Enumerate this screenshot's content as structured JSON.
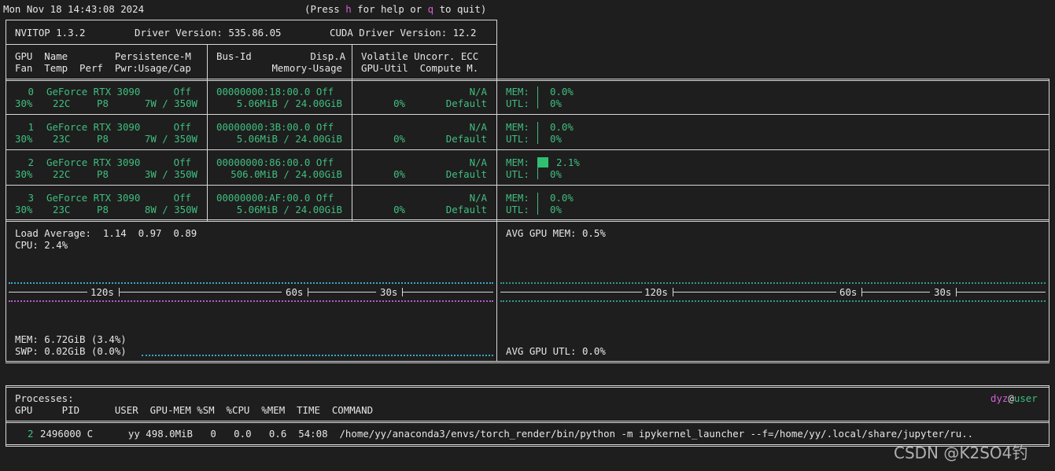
{
  "header": {
    "datetime": "Mon Nov 18 14:43:08 2024",
    "help_prefix": "(Press ",
    "help_key": "h",
    "help_mid": " for help or ",
    "quit_key": "q",
    "help_suffix": " to quit)"
  },
  "info": {
    "version": "NVITOP 1.3.2",
    "driver": "Driver Version: 535.86.05",
    "cuda": "CUDA Driver Version: 12.2"
  },
  "columns": {
    "c1_l1": "GPU  Name        Persistence-M",
    "c1_l2": "Fan  Temp  Perf  Pwr:Usage/Cap",
    "c2_l1": "Bus-Id          Disp.A",
    "c2_l2": "Memory-Usage",
    "c3_l1": "Volatile Uncorr. ECC",
    "c3_l2": "GPU-Util  Compute M."
  },
  "gpus": [
    {
      "id": "0",
      "name": "GeForce RTX 3090",
      "persist": "Off",
      "fan": "30%",
      "temp": "22C",
      "perf": "P8",
      "pwr": "7W / 350W",
      "bus": "00000000:18:00.0 Off",
      "mem": "5.06MiB / 24.00GiB",
      "ecc": "N/A",
      "util": "0%",
      "compute": "Default",
      "mem_label": "MEM:",
      "mem_pct": "0.0%",
      "mem_fraction": 0.0,
      "utl_label": "UTL:",
      "utl_pct": "0%"
    },
    {
      "id": "1",
      "name": "GeForce RTX 3090",
      "persist": "Off",
      "fan": "30%",
      "temp": "23C",
      "perf": "P8",
      "pwr": "7W / 350W",
      "bus": "00000000:3B:00.0 Off",
      "mem": "5.06MiB / 24.00GiB",
      "ecc": "N/A",
      "util": "0%",
      "compute": "Default",
      "mem_label": "MEM:",
      "mem_pct": "0.0%",
      "mem_fraction": 0.0,
      "utl_label": "UTL:",
      "utl_pct": "0%"
    },
    {
      "id": "2",
      "name": "GeForce RTX 3090",
      "persist": "Off",
      "fan": "30%",
      "temp": "22C",
      "perf": "P8",
      "pwr": "3W / 350W",
      "bus": "00000000:86:00.0 Off",
      "mem": "506.0MiB / 24.00GiB",
      "ecc": "N/A",
      "util": "0%",
      "compute": "Default",
      "mem_label": "MEM:",
      "mem_pct": "2.1%",
      "mem_fraction": 0.021,
      "utl_label": "UTL:",
      "utl_pct": "0%"
    },
    {
      "id": "3",
      "name": "GeForce RTX 3090",
      "persist": "Off",
      "fan": "30%",
      "temp": "23C",
      "perf": "P8",
      "pwr": "8W / 350W",
      "bus": "00000000:AF:00.0 Off",
      "mem": "5.06MiB / 24.00GiB",
      "ecc": "N/A",
      "util": "0%",
      "compute": "Default",
      "mem_label": "MEM:",
      "mem_pct": "0.0%",
      "mem_fraction": 0.0,
      "utl_label": "UTL:",
      "utl_pct": "0%"
    }
  ],
  "host": {
    "load": "Load Average:  1.14  0.97  0.89",
    "cpu": "CPU: 2.4%",
    "mem": "MEM: 6.72GiB (3.4%)",
    "swp": "SWP: 0.02GiB (0.0%)",
    "avg_gpu_mem": "AVG GPU MEM: 0.5%",
    "avg_gpu_utl": "AVG GPU UTL: 0.0%",
    "time_labels": [
      "120s",
      "60s",
      "30s"
    ]
  },
  "processes": {
    "title": "Processes:",
    "user": "dyz",
    "at": "@",
    "host": "user",
    "headers": "GPU     PID      USER  GPU-MEM %SM  %CPU  %MEM  TIME  COMMAND",
    "rows": [
      {
        "gpu": "2",
        "rest": "2496000 C      yy 498.0MiB   0   0.0   0.6  54:08  /home/yy/anaconda3/envs/torch_render/bin/python -m ipykernel_launcher --f=/home/yy/.local/share/jupyter/ru.."
      }
    ]
  },
  "watermark": "CSDN @K2SO4钓",
  "colors": {
    "accent_green": "#3fbf7f",
    "key_magenta": "#d45fd4",
    "cpu_dots": "#3aa7c7",
    "mem_dots": "#b45bd0",
    "gpu_dots": "#2f9c8a"
  }
}
